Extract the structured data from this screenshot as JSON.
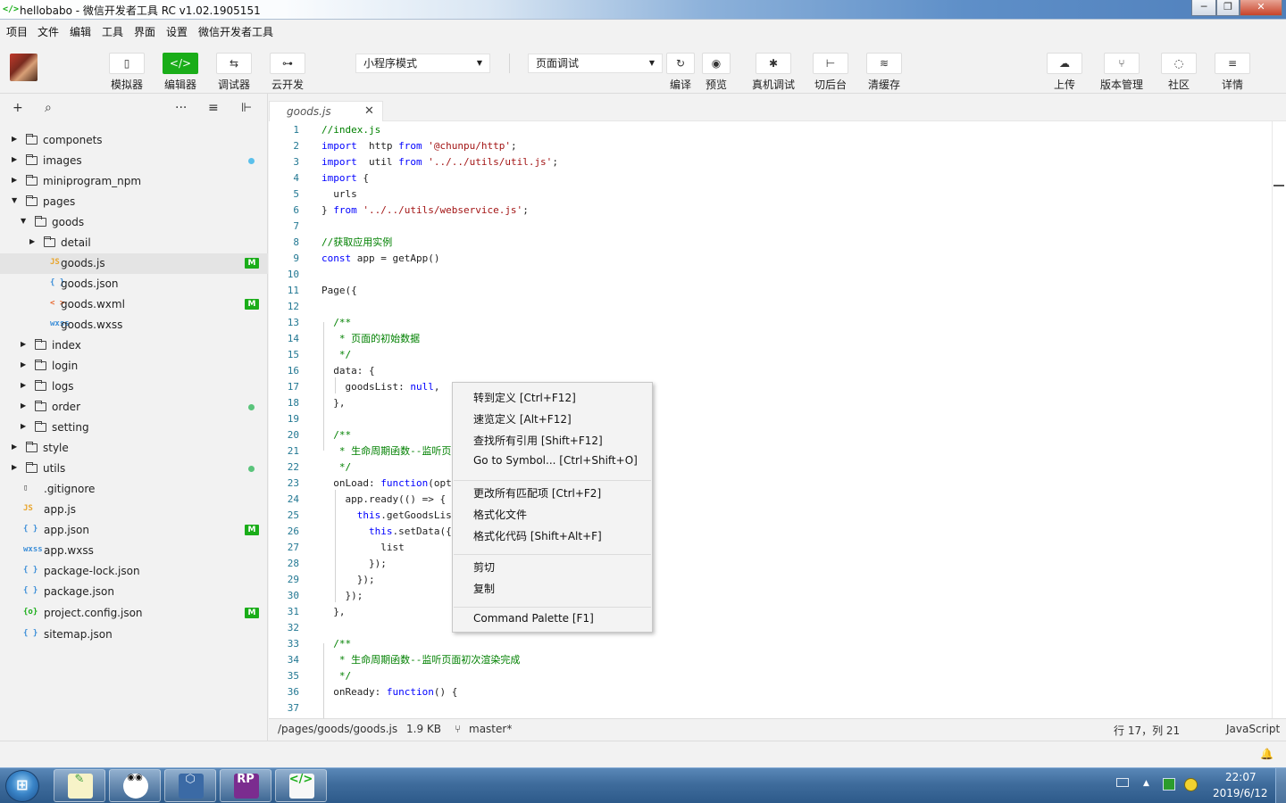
{
  "window": {
    "title": "hellobabo - 微信开发者工具 RC v1.02.1905151",
    "min": "─",
    "max": "❐",
    "close": "✕"
  },
  "menubar": [
    "项目",
    "文件",
    "编辑",
    "工具",
    "界面",
    "设置",
    "微信开发者工具"
  ],
  "toolbar": {
    "left": [
      {
        "icon": "phone-icon",
        "glyph": "▯",
        "label": "模拟器"
      },
      {
        "icon": "code-icon",
        "glyph": "</>",
        "label": "编辑器",
        "active": true
      },
      {
        "icon": "debug-icon",
        "glyph": "⇆",
        "label": "调试器"
      },
      {
        "icon": "cloud-link-icon",
        "glyph": "⊶",
        "label": "云开发"
      }
    ],
    "mode_select": "小程序模式",
    "compile_select": "页面调试",
    "middle": [
      {
        "icon": "refresh-icon",
        "glyph": "↻",
        "label": "编译"
      },
      {
        "icon": "eye-icon",
        "glyph": "◉",
        "label": "预览"
      },
      {
        "icon": "bug-icon",
        "glyph": "✱",
        "label": "真机调试"
      },
      {
        "icon": "background-icon",
        "glyph": "⊢",
        "label": "切后台"
      },
      {
        "icon": "layers-icon",
        "glyph": "≋",
        "label": "清缓存"
      }
    ],
    "right": [
      {
        "icon": "upload-icon",
        "glyph": "☁",
        "label": "上传"
      },
      {
        "icon": "branch-icon",
        "glyph": "⑂",
        "label": "版本管理"
      },
      {
        "icon": "chat-icon",
        "glyph": "◌",
        "label": "社区"
      },
      {
        "icon": "menu-icon",
        "glyph": "≡",
        "label": "详情"
      }
    ]
  },
  "sidebar_tools": {
    "add": "+",
    "search": "⌕",
    "more": "···",
    "sort": "≡",
    "collapse": "⊩"
  },
  "tree": [
    {
      "name": "componets",
      "type": "folder",
      "depth": 0,
      "open": false
    },
    {
      "name": "images",
      "type": "folder",
      "depth": 0,
      "open": false,
      "dot": "#5bc0eb"
    },
    {
      "name": "miniprogram_npm",
      "type": "folder",
      "depth": 0,
      "open": false
    },
    {
      "name": "pages",
      "type": "folder",
      "depth": 0,
      "open": true
    },
    {
      "name": "goods",
      "type": "folder",
      "depth": 1,
      "open": true
    },
    {
      "name": "detail",
      "type": "folder",
      "depth": 2,
      "open": false
    },
    {
      "name": "goods.js",
      "type": "js",
      "depth": 2,
      "badge": "M",
      "active": true
    },
    {
      "name": "goods.json",
      "type": "json",
      "depth": 2
    },
    {
      "name": "goods.wxml",
      "type": "wxml",
      "depth": 2,
      "badge": "M"
    },
    {
      "name": "goods.wxss",
      "type": "wxss",
      "depth": 2
    },
    {
      "name": "index",
      "type": "folder",
      "depth": 1,
      "open": false
    },
    {
      "name": "login",
      "type": "folder",
      "depth": 1,
      "open": false
    },
    {
      "name": "logs",
      "type": "folder",
      "depth": 1,
      "open": false
    },
    {
      "name": "order",
      "type": "folder",
      "depth": 1,
      "open": false,
      "dot": "#5ac47b"
    },
    {
      "name": "setting",
      "type": "folder",
      "depth": 1,
      "open": false
    },
    {
      "name": "style",
      "type": "folder",
      "depth": 0,
      "open": false
    },
    {
      "name": "utils",
      "type": "folder",
      "depth": 0,
      "open": false,
      "dot": "#5ac47b"
    },
    {
      "name": ".gitignore",
      "type": "file",
      "depth": 0
    },
    {
      "name": "app.js",
      "type": "js",
      "depth": 0
    },
    {
      "name": "app.json",
      "type": "json",
      "depth": 0,
      "badge": "M"
    },
    {
      "name": "app.wxss",
      "type": "wxss",
      "depth": 0
    },
    {
      "name": "package-lock.json",
      "type": "json",
      "depth": 0
    },
    {
      "name": "package.json",
      "type": "json",
      "depth": 0
    },
    {
      "name": "project.config.json",
      "type": "config",
      "depth": 0,
      "badge": "M"
    },
    {
      "name": "sitemap.json",
      "type": "json",
      "depth": 0
    }
  ],
  "file_icons": {
    "js": "JS",
    "json": "{ }",
    "wxml": "< >",
    "wxss": "wxss",
    "config": "{o}",
    "file": "▯"
  },
  "editor_tab": {
    "name": "goods.js",
    "close": "✕"
  },
  "code": [
    [
      [
        "cm",
        "//index.js"
      ]
    ],
    [
      [
        "kw",
        "import"
      ],
      [
        "",
        "  http "
      ],
      [
        "kw",
        "from"
      ],
      [
        "st",
        " '@chunpu/http'"
      ],
      [
        "",
        ";"
      ]
    ],
    [
      [
        "kw",
        "import"
      ],
      [
        "",
        "  util "
      ],
      [
        "kw",
        "from"
      ],
      [
        "st",
        " '../../utils/util.js'"
      ],
      [
        "",
        ";"
      ]
    ],
    [
      [
        "kw",
        "import"
      ],
      [
        "",
        " {"
      ]
    ],
    [
      [
        "",
        "  urls"
      ]
    ],
    [
      [
        "",
        "} "
      ],
      [
        "kw",
        "from"
      ],
      [
        "st",
        " '../../utils/webservice.js'"
      ],
      [
        "",
        ";"
      ]
    ],
    [
      [
        "",
        ""
      ]
    ],
    [
      [
        "cm",
        "//获取应用实例"
      ]
    ],
    [
      [
        "kw",
        "const"
      ],
      [
        "",
        " app = getApp()"
      ]
    ],
    [
      [
        "",
        ""
      ]
    ],
    [
      [
        "",
        "Page({"
      ]
    ],
    [
      [
        "",
        ""
      ]
    ],
    [
      [
        "cm",
        "  /**"
      ]
    ],
    [
      [
        "cm",
        "   * 页面的初始数据"
      ]
    ],
    [
      [
        "cm",
        "   */"
      ]
    ],
    [
      [
        "",
        "  data: {"
      ]
    ],
    [
      [
        "",
        "    goodsList: "
      ],
      [
        "kw",
        "null"
      ],
      [
        "",
        ","
      ]
    ],
    [
      [
        "",
        "  },"
      ]
    ],
    [
      [
        "",
        ""
      ]
    ],
    [
      [
        "cm",
        "  /**"
      ]
    ],
    [
      [
        "cm",
        "   * 生命周期函数--监听页面加载"
      ]
    ],
    [
      [
        "cm",
        "   */"
      ]
    ],
    [
      [
        "",
        "  onLoad: "
      ],
      [
        "kw",
        "function"
      ],
      [
        "",
        "(options) {"
      ]
    ],
    [
      [
        "",
        "    app.ready(() => {"
      ]
    ],
    [
      [
        "",
        "      "
      ],
      [
        "kw",
        "this"
      ],
      [
        "",
        ".getGoodsList();"
      ]
    ],
    [
      [
        "",
        "        "
      ],
      [
        "kw",
        "this"
      ],
      [
        "",
        ".setData({"
      ]
    ],
    [
      [
        "",
        "          list"
      ]
    ],
    [
      [
        "",
        "        });"
      ]
    ],
    [
      [
        "",
        "      });"
      ]
    ],
    [
      [
        "",
        "    });"
      ]
    ],
    [
      [
        "",
        "  },"
      ]
    ],
    [
      [
        "",
        ""
      ]
    ],
    [
      [
        "cm",
        "  /**"
      ]
    ],
    [
      [
        "cm",
        "   * 生命周期函数--监听页面初次渲染完成"
      ]
    ],
    [
      [
        "cm",
        "   */"
      ]
    ],
    [
      [
        "",
        "  onReady: "
      ],
      [
        "kw",
        "function"
      ],
      [
        "",
        "() {"
      ]
    ],
    [
      [
        "",
        ""
      ]
    ]
  ],
  "context_menu": {
    "groups": [
      [
        "转到定义  [Ctrl+F12]",
        "速览定义  [Alt+F12]",
        "查找所有引用  [Shift+F12]",
        "Go to Symbol...  [Ctrl+Shift+O]"
      ],
      [
        "更改所有匹配项  [Ctrl+F2]",
        "格式化文件",
        "格式化代码  [Shift+Alt+F]"
      ],
      [
        "剪切",
        "复制"
      ],
      [
        "Command Palette  [F1]"
      ]
    ]
  },
  "status": {
    "path": "/pages/goods/goods.js",
    "size": "1.9 KB",
    "branch": "master*",
    "branch_icon": "⑂",
    "position": "行 17，列 21",
    "language": "JavaScript"
  },
  "bottombar": {
    "bell": "🔔"
  },
  "taskbar": {
    "start": "⊞",
    "apps": [
      {
        "name": "notepad-icon",
        "glyph": "✎",
        "color": "#3a9b3a"
      },
      {
        "name": "incognito-icon",
        "glyph": "◉◉",
        "color": "#111"
      },
      {
        "name": "box-icon",
        "glyph": "⬡",
        "color": "#dfeaf6"
      },
      {
        "name": "axure-rp-icon",
        "glyph": "RP",
        "color": "#fff"
      },
      {
        "name": "wechat-devtools-icon",
        "glyph": "</>",
        "color": "#1aad19"
      }
    ],
    "time": "22:07",
    "date": "2019/6/12"
  }
}
